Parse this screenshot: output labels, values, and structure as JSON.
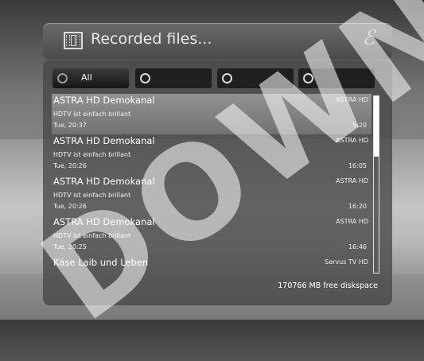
{
  "header": {
    "title": "Recorded files...",
    "icon": "film-icon",
    "logo": "ℰ"
  },
  "watermark": "DOWN",
  "filters": [
    {
      "label": "All",
      "active": true
    },
    {
      "label": "",
      "active": false
    },
    {
      "label": "",
      "active": false
    },
    {
      "label": "",
      "active": false
    }
  ],
  "recordings": [
    {
      "title": "ASTRA HD Demokanal",
      "channel": "ASTRA HD",
      "desc": "HDTV ist einfach brillant",
      "datetime": "Tue, 20:37",
      "duration": "5:20"
    },
    {
      "title": "ASTRA HD Demokanal",
      "channel": "ASTRA HD",
      "desc": "HDTV ist einfach brillant",
      "datetime": "Tue, 20:26",
      "duration": "16:05"
    },
    {
      "title": "ASTRA HD Demokanal",
      "channel": "ASTRA HD",
      "desc": "HDTV ist einfach brillant",
      "datetime": "Tue, 20:26",
      "duration": "16:20"
    },
    {
      "title": "ASTRA HD Demokanal",
      "channel": "ASTRA HD",
      "desc": "HDTV ist einfach brillant",
      "datetime": "Tue, 20:25",
      "duration": "16:46"
    },
    {
      "title": "Käse Laib und Leben",
      "channel": "Servus TV HD"
    }
  ],
  "footer": {
    "free_space": "170766 MB free diskspace"
  }
}
